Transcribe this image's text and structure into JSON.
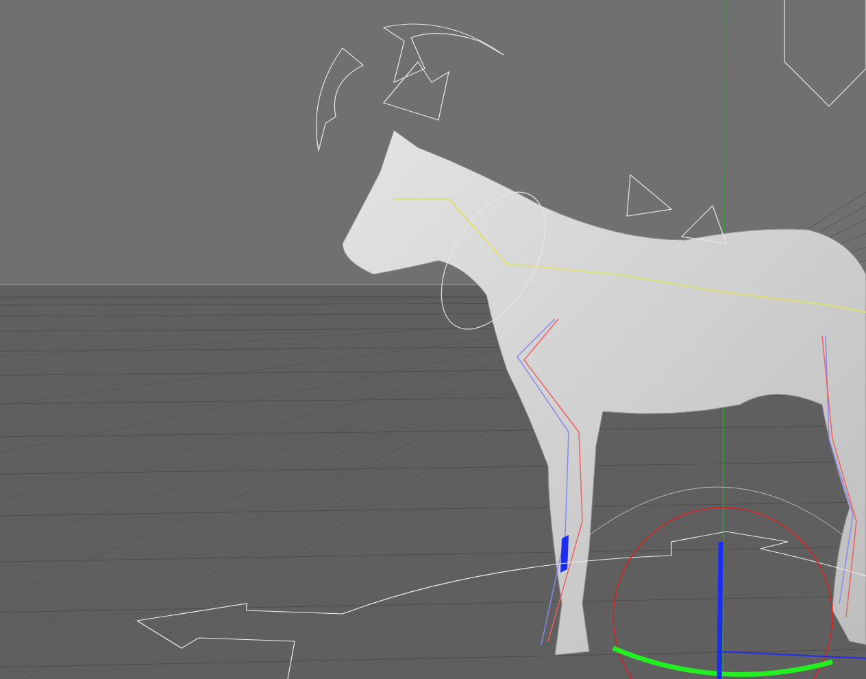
{
  "viewport": {
    "grid_visible": true,
    "world_axis_visible": true
  }
}
